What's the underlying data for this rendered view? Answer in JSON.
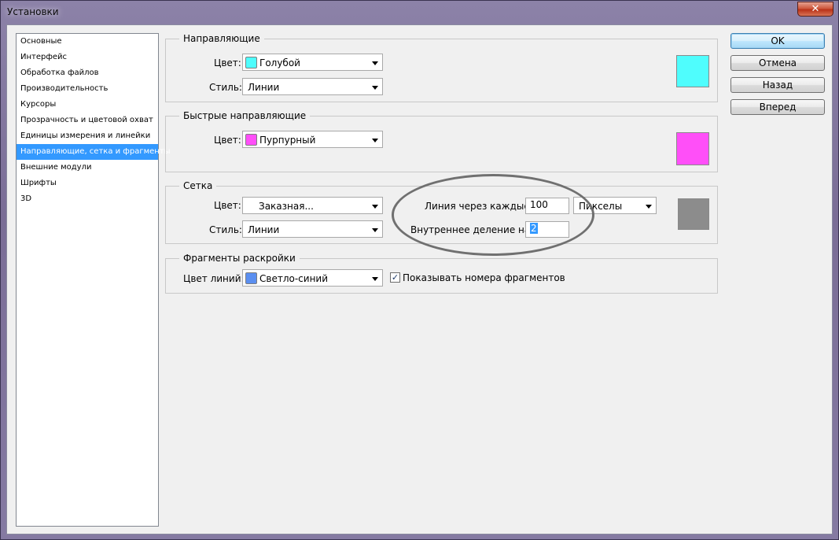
{
  "window": {
    "title": "Установки",
    "close_glyph": "✕"
  },
  "sidebar": {
    "items": [
      {
        "label": "Основные"
      },
      {
        "label": "Интерфейс"
      },
      {
        "label": "Обработка файлов"
      },
      {
        "label": "Производительность"
      },
      {
        "label": "Курсоры"
      },
      {
        "label": "Прозрачность и цветовой охват"
      },
      {
        "label": "Единицы измерения и линейки"
      },
      {
        "label": "Направляющие, сетка и фрагменты",
        "selected": true
      },
      {
        "label": "Внешние модули"
      },
      {
        "label": "Шрифты"
      },
      {
        "label": "3D"
      }
    ]
  },
  "guides": {
    "title": "Направляющие",
    "color_label": "Цвет:",
    "color_value": "Голубой",
    "color_hex": "#4ffdfd",
    "style_label": "Стиль:",
    "style_value": "Линии"
  },
  "smart_guides": {
    "title": "Быстрые направляющие",
    "color_label": "Цвет:",
    "color_value": "Пурпурный",
    "color_hex": "#ff4ff8"
  },
  "grid": {
    "title": "Сетка",
    "color_label": "Цвет:",
    "color_value": "Заказная...",
    "color_hex": "#8c8c8c",
    "style_label": "Стиль:",
    "style_value": "Линии",
    "gridline_label": "Линия через каждые:",
    "gridline_value": "100",
    "units_value": "Пикселы",
    "subdiv_label": "Внутреннее деление на:",
    "subdiv_value": "2"
  },
  "slices": {
    "title": "Фрагменты раскройки",
    "line_color_label": "Цвет линий:",
    "line_color_value": "Светло-синий",
    "line_color_hex": "#5b8ff0",
    "show_numbers_label": "Показывать номера фрагментов",
    "show_numbers_checked": true,
    "check_glyph": "✓"
  },
  "buttons": {
    "ok": "OK",
    "cancel": "Отмена",
    "back": "Назад",
    "next": "Вперед"
  },
  "colors": {
    "selection": "#3399ff",
    "panel_bg": "#f0f0f0"
  }
}
